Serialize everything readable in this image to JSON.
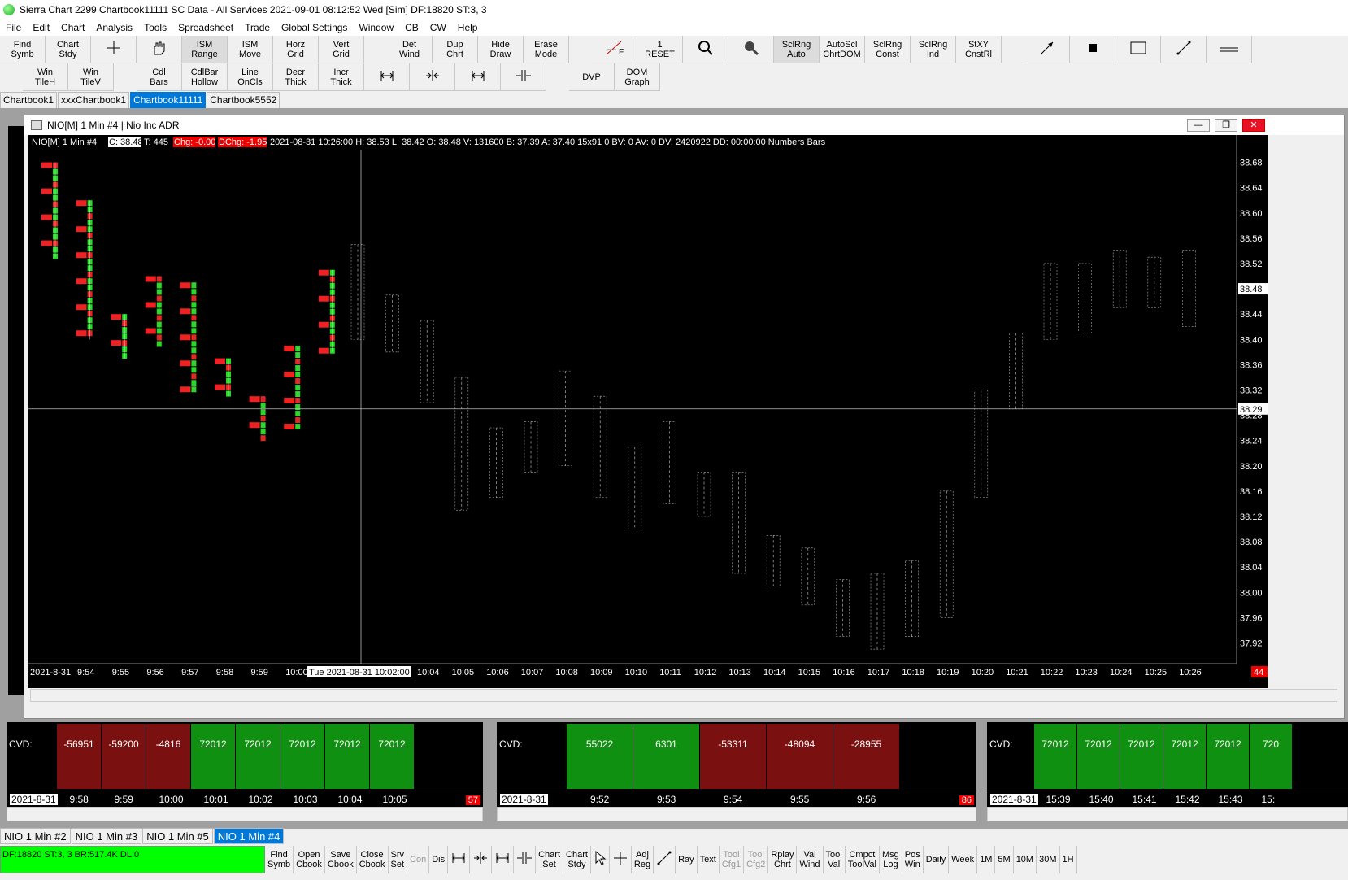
{
  "window": {
    "title": "Sierra Chart 2299 Chartbook11111  SC Data - All Services 2021-09-01  08:12:52 Wed [Sim]  DF:18820  ST:3, 3"
  },
  "menu": [
    "File",
    "Edit",
    "Chart",
    "Analysis",
    "Tools",
    "Spreadsheet",
    "Trade",
    "Global Settings",
    "Window",
    "CB",
    "CW",
    "Help"
  ],
  "toolbar1": [
    {
      "l1": "Find",
      "l2": "Symb"
    },
    {
      "l1": "Chart",
      "l2": "Stdy"
    },
    {
      "icon": "crosshair"
    },
    {
      "icon": "hand"
    },
    {
      "l1": "ISM",
      "l2": "Range",
      "sel": true
    },
    {
      "l1": "ISM",
      "l2": "Move"
    },
    {
      "l1": "Horz",
      "l2": "Grid"
    },
    {
      "l1": "Vert",
      "l2": "Grid"
    },
    {
      "gap": true
    },
    {
      "l1": "Det",
      "l2": "Wind"
    },
    {
      "l1": "Dup",
      "l2": "Chrt"
    },
    {
      "l1": "Hide",
      "l2": "Draw"
    },
    {
      "l1": "Erase",
      "l2": "Mode"
    },
    {
      "gap": true
    },
    {
      "icon": "fib",
      "l2": "F"
    },
    {
      "l1": "1",
      "l2": "RESET"
    },
    {
      "icon": "zoom"
    },
    {
      "icon": "zoomfill"
    },
    {
      "l1": "SclRng",
      "l2": "Auto",
      "sel": true
    },
    {
      "l1": "AutoScl",
      "l2": "ChrtDOM"
    },
    {
      "l1": "SclRng",
      "l2": "Const"
    },
    {
      "l1": "SclRng",
      "l2": "Ind"
    },
    {
      "l1": "StXY",
      "l2": "CnstRl"
    },
    {
      "gap": true
    },
    {
      "icon": "arrow"
    },
    {
      "icon": "square"
    },
    {
      "icon": "rect"
    },
    {
      "icon": "line"
    },
    {
      "icon": "hline"
    }
  ],
  "toolbar2": [
    {
      "gap": true
    },
    {
      "l1": "Win",
      "l2": "TileH"
    },
    {
      "l1": "Win",
      "l2": "TileV"
    },
    {
      "gap": true
    },
    {
      "l1": "Cdl",
      "l2": "Bars"
    },
    {
      "l1": "CdlBar",
      "l2": "Hollow"
    },
    {
      "l1": "Line",
      "l2": "OnCls"
    },
    {
      "l1": "Decr",
      "l2": "Thick"
    },
    {
      "l1": "Incr",
      "l2": "Thick"
    },
    {
      "icon": "sp1"
    },
    {
      "icon": "sp2"
    },
    {
      "icon": "sp3"
    },
    {
      "icon": "sp4"
    },
    {
      "gap": true
    },
    {
      "l1": "",
      "l2": "DVP"
    },
    {
      "l1": "DOM",
      "l2": "Graph"
    }
  ],
  "chartbook_tabs": [
    {
      "label": "Chartbook1"
    },
    {
      "label": "xxxChartbook1"
    },
    {
      "label": "Chartbook11111",
      "active": true
    },
    {
      "label": "Chartbook5552"
    }
  ],
  "main_window": {
    "title": "NIO[M]  1 Min  #4 | Nio Inc ADR"
  },
  "chart_header": {
    "symbol": "NIO[M]   1 Min    #4",
    "close": "C: 38.48",
    "trades": "T: 445",
    "chg": "Chg: -0.00",
    "dchg": "DChg: -1.95",
    "rest": "2021-08-31 10:26:00 H: 38.53 L: 38.42 O: 38.48 V: 131600 B: 37.39 A: 37.40 15x91 0 BV: 0 AV: 0 DV: 2420922 DD: 00:00:00 Numbers Bars"
  },
  "chart_data": {
    "type": "bar",
    "yticks": [
      "38.68",
      "38.64",
      "38.60",
      "38.56",
      "38.52",
      "38.48",
      "38.44",
      "38.40",
      "38.36",
      "38.32",
      "38.29",
      "38.28",
      "38.24",
      "38.20",
      "38.16",
      "38.12",
      "38.08",
      "38.04",
      "38.00",
      "37.96",
      "37.92"
    ],
    "ylim": [
      37.9,
      38.7
    ],
    "last_price": "38.48",
    "crosshair_price": "38.29",
    "xticks": [
      "2021-8-31",
      "9:54",
      "9:55",
      "9:56",
      "9:57",
      "9:58",
      "9:59",
      "10:00",
      "Tue 2021-08-31  10:02:00",
      "10:04",
      "10:05",
      "10:06",
      "10:07",
      "10:08",
      "10:09",
      "10:10",
      "10:11",
      "10:12",
      "10:13",
      "10:14",
      "10:15",
      "10:16",
      "10:17",
      "10:18",
      "10:19",
      "10:20",
      "10:21",
      "10:22",
      "10:23",
      "10:24",
      "10:25",
      "10:26"
    ],
    "bar_count": "44",
    "colored_bars": [
      {
        "x": 0,
        "low": 38.53,
        "high": 38.68
      },
      {
        "x": 1,
        "low": 38.4,
        "high": 38.62
      },
      {
        "x": 2,
        "low": 38.37,
        "high": 38.44
      },
      {
        "x": 3,
        "low": 38.39,
        "high": 38.5
      },
      {
        "x": 4,
        "low": 38.31,
        "high": 38.49
      },
      {
        "x": 5,
        "low": 38.31,
        "high": 38.37
      },
      {
        "x": 6,
        "low": 38.24,
        "high": 38.31
      },
      {
        "x": 7,
        "low": 38.26,
        "high": 38.39
      },
      {
        "x": 8,
        "low": 38.38,
        "high": 38.51
      }
    ],
    "mono_bars": [
      {
        "x": 9,
        "low": 38.4,
        "high": 38.55
      },
      {
        "x": 10,
        "low": 38.38,
        "high": 38.47
      },
      {
        "x": 11,
        "low": 38.3,
        "high": 38.43
      },
      {
        "x": 12,
        "low": 38.13,
        "high": 38.34
      },
      {
        "x": 13,
        "low": 38.15,
        "high": 38.26
      },
      {
        "x": 14,
        "low": 38.19,
        "high": 38.27
      },
      {
        "x": 15,
        "low": 38.2,
        "high": 38.35
      },
      {
        "x": 16,
        "low": 38.15,
        "high": 38.31
      },
      {
        "x": 17,
        "low": 38.1,
        "high": 38.23
      },
      {
        "x": 18,
        "low": 38.14,
        "high": 38.27
      },
      {
        "x": 19,
        "low": 38.12,
        "high": 38.19
      },
      {
        "x": 20,
        "low": 38.03,
        "high": 38.19
      },
      {
        "x": 21,
        "low": 38.01,
        "high": 38.09
      },
      {
        "x": 22,
        "low": 37.98,
        "high": 38.07
      },
      {
        "x": 23,
        "low": 37.93,
        "high": 38.02
      },
      {
        "x": 24,
        "low": 37.91,
        "high": 38.03
      },
      {
        "x": 25,
        "low": 37.93,
        "high": 38.05
      },
      {
        "x": 26,
        "low": 37.96,
        "high": 38.16
      },
      {
        "x": 27,
        "low": 38.15,
        "high": 38.32
      },
      {
        "x": 28,
        "low": 38.29,
        "high": 38.41
      },
      {
        "x": 29,
        "low": 38.4,
        "high": 38.52
      },
      {
        "x": 30,
        "low": 38.41,
        "high": 38.52
      },
      {
        "x": 31,
        "low": 38.45,
        "high": 38.54
      },
      {
        "x": 32,
        "low": 38.45,
        "high": 38.53
      },
      {
        "x": 33,
        "low": 38.42,
        "high": 38.54
      }
    ]
  },
  "sub1": {
    "label": "CVD:",
    "date": "2021-8-31",
    "count": "57",
    "blocks": [
      {
        "v": "-56951",
        "c": "#7a1010"
      },
      {
        "v": "-59200",
        "c": "#7a1010"
      },
      {
        "v": "-4816",
        "c": "#7a1010"
      },
      {
        "v": "72012",
        "c": "#109010"
      },
      {
        "v": "72012",
        "c": "#109010"
      },
      {
        "v": "72012",
        "c": "#109010"
      },
      {
        "v": "72012",
        "c": "#109010"
      },
      {
        "v": "72012",
        "c": "#109010"
      }
    ],
    "times": [
      "9:58",
      "9:59",
      "10:00",
      "10:01",
      "10:02",
      "10:03",
      "10:04",
      "10:05"
    ]
  },
  "sub2": {
    "label": "CVD:",
    "date": "2021-8-31",
    "count": "86",
    "blocks": [
      {
        "v": "55022",
        "c": "#109010"
      },
      {
        "v": "6301",
        "c": "#109010"
      },
      {
        "v": "-53311",
        "c": "#7a1010"
      },
      {
        "v": "-48094",
        "c": "#7a1010"
      },
      {
        "v": "-28955",
        "c": "#7a1010"
      }
    ],
    "times": [
      "9:52",
      "9:53",
      "9:54",
      "9:55",
      "9:56"
    ]
  },
  "sub3": {
    "label": "CVD:",
    "date": "2021-8-31",
    "blocks": [
      {
        "v": "72012",
        "c": "#109010"
      },
      {
        "v": "72012",
        "c": "#109010"
      },
      {
        "v": "72012",
        "c": "#109010"
      },
      {
        "v": "72012",
        "c": "#109010"
      },
      {
        "v": "72012",
        "c": "#109010"
      },
      {
        "v": "720",
        "c": "#109010"
      }
    ],
    "times": [
      "15:39",
      "15:40",
      "15:41",
      "15:42",
      "15:43",
      "15:"
    ]
  },
  "bottom_tabs": [
    {
      "label": "NIO  1 Min   #2"
    },
    {
      "label": "NIO  1 Min   #3"
    },
    {
      "label": "NIO  1 Min   #5"
    },
    {
      "label": "NIO  1 Min   #4",
      "active": true
    }
  ],
  "status": "DF:18820  ST:3, 3   BR:517.4K  DL:0",
  "bottom_toolbar": [
    {
      "l1": "Find",
      "l2": "Symb"
    },
    {
      "l1": "Open",
      "l2": "Cbook"
    },
    {
      "l1": "Save",
      "l2": "Cbook"
    },
    {
      "l1": "Close",
      "l2": "Cbook"
    },
    {
      "l1": "Srv",
      "l2": "Set"
    },
    {
      "l1": "",
      "l2": "Con",
      "dis": true
    },
    {
      "l1": "",
      "l2": "Dis"
    },
    {
      "icon": "sp1"
    },
    {
      "icon": "sp2"
    },
    {
      "icon": "sp3"
    },
    {
      "icon": "sp4"
    },
    {
      "l1": "Chart",
      "l2": "Set"
    },
    {
      "l1": "Chart",
      "l2": "Stdy"
    },
    {
      "icon": "pointer"
    },
    {
      "icon": "crosshair"
    },
    {
      "l1": "Adj",
      "l2": "Reg"
    },
    {
      "icon": "line"
    },
    {
      "l1": "",
      "l2": "Ray"
    },
    {
      "l1": "",
      "l2": "Text"
    },
    {
      "l1": "Tool",
      "l2": "Cfg1",
      "dis": true
    },
    {
      "l1": "Tool",
      "l2": "Cfg2",
      "dis": true
    },
    {
      "l1": "Rplay",
      "l2": "Chrt"
    },
    {
      "l1": "Val",
      "l2": "Wind"
    },
    {
      "l1": "Tool",
      "l2": "Val"
    },
    {
      "l1": "Cmpct",
      "l2": "ToolVal"
    },
    {
      "l1": "Msg",
      "l2": "Log"
    },
    {
      "l1": "Pos",
      "l2": "Win"
    },
    {
      "l1": "",
      "l2": "Daily"
    },
    {
      "l1": "",
      "l2": "Week"
    },
    {
      "l1": "",
      "l2": "1M"
    },
    {
      "l1": "",
      "l2": "5M"
    },
    {
      "l1": "",
      "l2": "10M"
    },
    {
      "l1": "",
      "l2": "30M"
    },
    {
      "l1": "",
      "l2": "1H"
    }
  ],
  "colors": {
    "up": "#22dd22",
    "down": "#ee2222",
    "chart_bg": "#000000",
    "accent": "#0078d7"
  }
}
